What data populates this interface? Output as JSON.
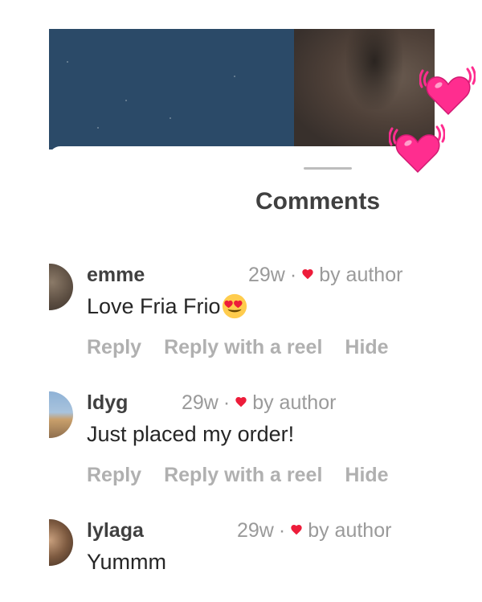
{
  "sheet": {
    "title": "Comments"
  },
  "comments": [
    {
      "username": "emme",
      "time": "29w",
      "dot": "·",
      "liked_label": "by author",
      "text": "Love Fria Frio",
      "emoji": "heart-eyes-emoji",
      "actions": {
        "reply": "Reply",
        "reply_reel": "Reply with a reel",
        "hide": "Hide"
      }
    },
    {
      "username": "ldyg",
      "time": "29w",
      "dot": "·",
      "liked_label": "by author",
      "text": "Just placed my order!",
      "actions": {
        "reply": "Reply",
        "reply_reel": "Reply with a reel",
        "hide": "Hide"
      }
    },
    {
      "username": "lylaga",
      "time": "29w",
      "dot": "·",
      "liked_label": "by author",
      "text": "Yummm"
    }
  ],
  "icons": {
    "liked_heart": "red-heart-icon",
    "floating_hearts": "beating-heart-sticker"
  },
  "colors": {
    "heart_red": "#ed1c3a",
    "sticker_pink": "#ff2d8f",
    "muted_text": "#9a9a9a",
    "action_text": "#b0b0b0",
    "video_bg": "#2b4a68"
  }
}
